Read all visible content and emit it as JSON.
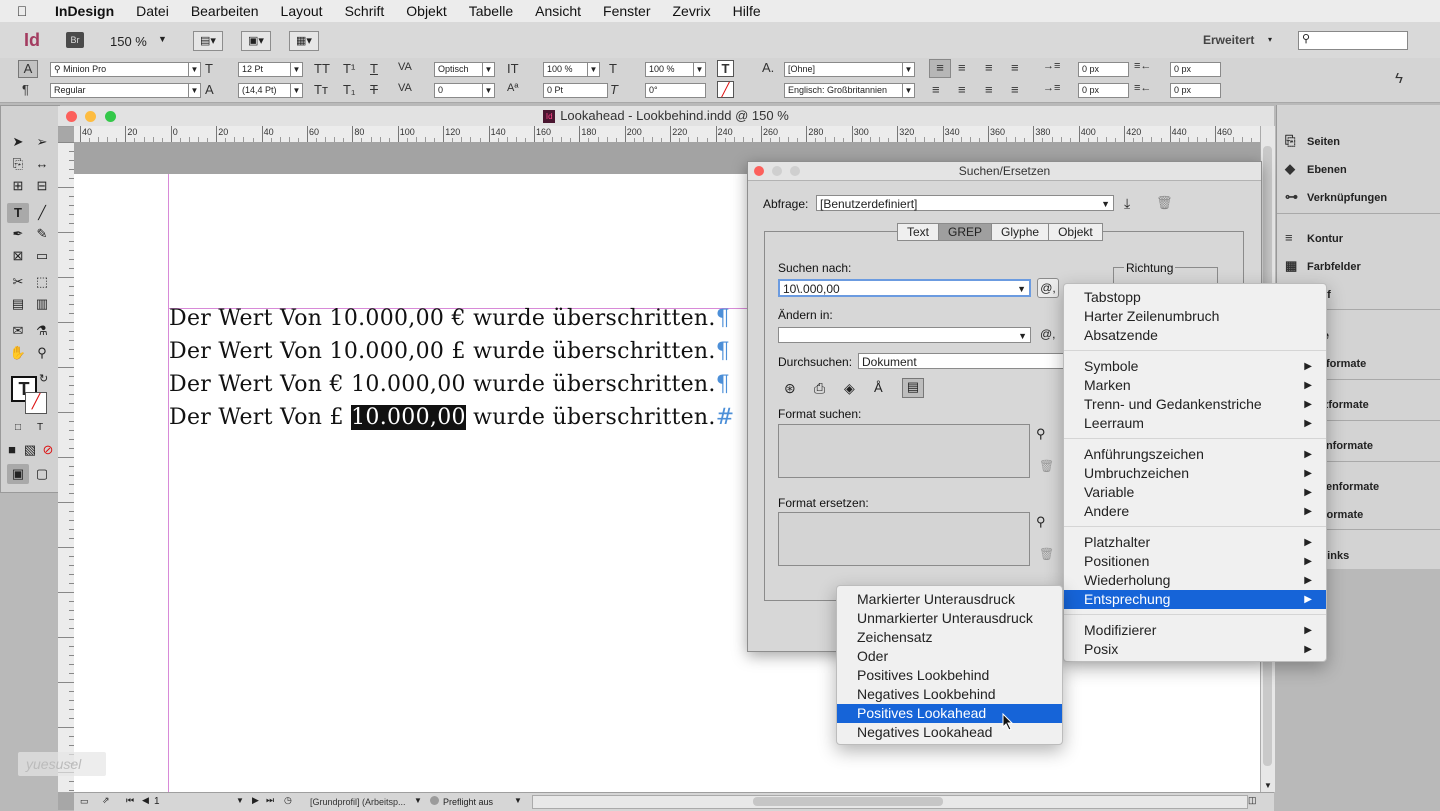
{
  "menubar": {
    "app": "InDesign",
    "items": [
      "Datei",
      "Bearbeiten",
      "Layout",
      "Schrift",
      "Objekt",
      "Tabelle",
      "Ansicht",
      "Fenster",
      "Zevrix",
      "Hilfe"
    ]
  },
  "appbar": {
    "logo": "Id",
    "bridge": "Br",
    "zoom": "150 %",
    "workspace": "Erweitert"
  },
  "controlbar": {
    "font": "Minion Pro",
    "style": "Regular",
    "size": "12 Pt",
    "leading": "(14,4 Pt)",
    "kerning": "Optisch",
    "tracking": "0",
    "vscale": "100 %",
    "hscale": "100 %",
    "baseline": "0 Pt",
    "skew": "0°",
    "charstyle": "[Ohne]",
    "language": "Englisch: Großbritannien",
    "indent_left": "0 px",
    "indent_right": "0 px",
    "indent_first": "0 px",
    "indent_last": "0 px"
  },
  "document": {
    "title": "Lookahead - Lookbehind.indd @ 150 %",
    "ruler_ticks": [
      "40",
      "20",
      "0",
      "20",
      "40",
      "60",
      "80",
      "100",
      "120",
      "140",
      "160",
      "180",
      "200",
      "220",
      "240",
      "260",
      "280",
      "300",
      "320",
      "340",
      "360",
      "380",
      "400",
      "420",
      "440",
      "460"
    ],
    "lines": [
      {
        "text": "Der Wert Von 10.000,00 € wurde überschritten.",
        "mark": "¶"
      },
      {
        "text": "Der Wert Von 10.000,00 £ wurde überschritten.",
        "mark": "¶"
      },
      {
        "text": "Der Wert Von € 10.000,00 wurde überschritten.",
        "mark": "¶"
      },
      {
        "pre": "Der Wert Von £ ",
        "sel": "10.000,00",
        "post": " wurde überschritten.",
        "mark": "#"
      }
    ],
    "status": {
      "page": "1",
      "profile": "[Grundprofil] (Arbeitsp...",
      "preflight": "Preflight aus"
    }
  },
  "right_panels": [
    "Seiten",
    "Ebenen",
    "Verknüpfungen",
    "Kontur",
    "Farbfelder",
    "rlauf",
    "ekte",
    "jektformate",
    "satzformate",
    "chenformate",
    "bellenformate",
    "lenformate",
    "perlinks"
  ],
  "dialog": {
    "title": "Suchen/Ersetzen",
    "query_label": "Abfrage:",
    "query_value": "[Benutzerdefiniert]",
    "tabs": [
      "Text",
      "GREP",
      "Glyphe",
      "Objekt"
    ],
    "active_tab": "GREP",
    "search_label": "Suchen nach:",
    "search_value": "10\\.000,00",
    "change_label": "Ändern in:",
    "change_value": "",
    "scope_label": "Durchsuchen:",
    "scope_value": "Dokument",
    "direction_label": "Richtung",
    "find_format_label": "Format suchen:",
    "change_format_label": "Format ersetzen:"
  },
  "menu_main": {
    "groups": [
      [
        {
          "label": "Tabstopp"
        },
        {
          "label": "Harter Zeilenumbruch"
        },
        {
          "label": "Absatzende"
        }
      ],
      [
        {
          "label": "Symbole",
          "sub": true
        },
        {
          "label": "Marken",
          "sub": true
        },
        {
          "label": "Trenn- und Gedankenstriche",
          "sub": true
        },
        {
          "label": "Leerraum",
          "sub": true
        }
      ],
      [
        {
          "label": "Anführungszeichen",
          "sub": true
        },
        {
          "label": "Umbruchzeichen",
          "sub": true
        },
        {
          "label": "Variable",
          "sub": true
        },
        {
          "label": "Andere",
          "sub": true
        }
      ],
      [
        {
          "label": "Platzhalter",
          "sub": true
        },
        {
          "label": "Positionen",
          "sub": true
        },
        {
          "label": "Wiederholung",
          "sub": true
        },
        {
          "label": "Entsprechung",
          "sub": true,
          "hot": true
        }
      ],
      [
        {
          "label": "Modifizierer",
          "sub": true
        },
        {
          "label": "Posix",
          "sub": true
        }
      ]
    ]
  },
  "menu_sub": {
    "items": [
      "Markierter Unterausdruck",
      "Unmarkierter Unterausdruck",
      "Zeichensatz",
      "Oder",
      "Positives Lookbehind",
      "Negatives Lookbehind",
      "Positives Lookahead",
      "Negatives Lookahead"
    ],
    "hot": "Positives Lookahead"
  },
  "watermark": "yuesusel",
  "colors": {
    "highlight": "#1664d8",
    "pilcrow": "#4c8fd8"
  }
}
